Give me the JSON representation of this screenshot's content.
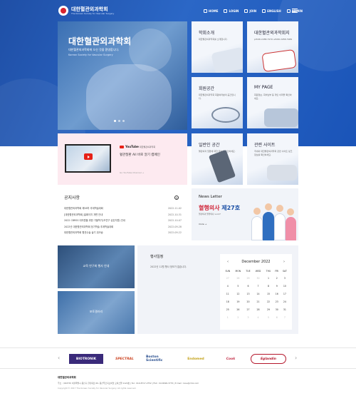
{
  "header": {
    "logo_title": "대한혈관외과학회",
    "logo_sub": "The Korean Society for Vascular Surgery",
    "nav": [
      "HOME",
      "LOGIN",
      "JOIN",
      "ENGLISH",
      "ADMIN"
    ]
  },
  "hero": {
    "title": "대한혈관외과학회",
    "subtitle": "대한혈관외과학회에 오신 것을 환영합니다.",
    "subtitle_en": "Korean Society for Vascular Surgery"
  },
  "tiles": [
    {
      "title": "학회소개",
      "desc": "대한혈관외과학회를 소개합니다."
    },
    {
      "title": "대한혈관외과학회지",
      "desc": "pISSN 2288-7970 eISSN 2288-7989"
    },
    {
      "title": "회원공간",
      "desc": "대한혈관외과학회 회원여러분의 공간입니다."
    },
    {
      "title": "MY PAGE",
      "desc": "회원정보, 회비납부 등 개인 이력을 확인하세요."
    },
    {
      "title": "일반인 공간",
      "desc": "혈관외과 질환에 대한 정보를 확인하세요."
    },
    {
      "title": "관련 사이트",
      "desc": "국내외 대한혈관외과학회 관련 사이트 링크 정보를 확인하세요."
    }
  ],
  "youtube": {
    "brand": "YouTube",
    "channel": "대한혈관외과학회",
    "title": "혈관질환 All 바로 알기 캠페인",
    "link": "Go YouTube Channel →"
  },
  "notice": {
    "heading": "공지사항",
    "items": [
      {
        "title": "대한혈관외과학회 제58차 추계학술대회",
        "date": "2022-11-02"
      },
      {
        "title": "[대한혈관외과학회] 홈페이지 개편 안내",
        "date": "2022-10-31"
      },
      {
        "title": "2022 CBRSS 대의원을 위한 가을학기(초연구 상호지원) 안내",
        "date": "2022-10-07"
      },
      {
        "title": "2022년 대한혈관외과학회 정기학술 추계학술대회",
        "date": "2022-09-28"
      },
      {
        "title": "대한혈관외과학회 혈관수술 술기 워크숍",
        "date": "2022-09-22"
      }
    ]
  },
  "newsletter": {
    "heading": "News Letter",
    "big_red": "혈행의사",
    "big_blue": " 제27호",
    "desc": "혈관외과 혈행의사 vol.27",
    "more": "more →"
  },
  "events": {
    "card1": "교육 연구회 행사 안내",
    "card2": "포토갤러리"
  },
  "schedule": {
    "heading": "행사일정",
    "none": "2022년 12월 행사 정보가 없습니다.",
    "month": "December 2022",
    "days": [
      "SUN",
      "MON",
      "TUE",
      "WED",
      "THU",
      "FRI",
      "SAT"
    ],
    "weeks": [
      [
        "27",
        "28",
        "29",
        "30",
        "1",
        "2",
        "3"
      ],
      [
        "4",
        "5",
        "6",
        "7",
        "8",
        "9",
        "10"
      ],
      [
        "11",
        "12",
        "13",
        "14",
        "15",
        "16",
        "17"
      ],
      [
        "18",
        "19",
        "20",
        "21",
        "22",
        "23",
        "24"
      ],
      [
        "25",
        "26",
        "27",
        "28",
        "29",
        "30",
        "31"
      ],
      [
        "1",
        "2",
        "3",
        "4",
        "5",
        "6",
        "7"
      ]
    ]
  },
  "partners": [
    "BIOTRONIK",
    "SPECTRAL",
    "Boston Scientific",
    "Endomed",
    "Cook",
    "Eglandin"
  ],
  "footer": {
    "name": "대한혈관외과학회",
    "address": "주소 : (04378) 서울특별시 용산구 한강대로 69, 용산푸르지오써밋 오피스텔 1124호  |  Tel : 010-8717-2752  |  FAX : 02-8490-3770  |  E-mail : ksvs@chol.com",
    "copy": "Copyright © 2017 The Korean Society for Vascular Surgery. All rights reserved."
  },
  "colors": {
    "brand": "#1f4fa6",
    "accent": "#d0263a"
  }
}
